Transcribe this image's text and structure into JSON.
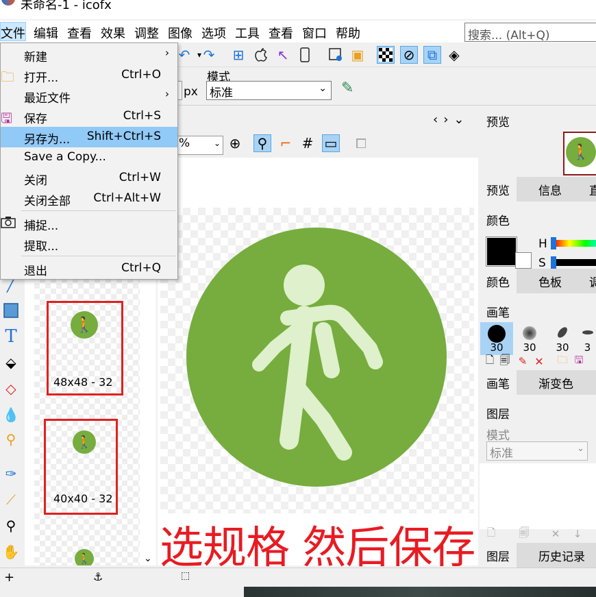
{
  "app": {
    "title": "未命名-1 - icofx"
  },
  "menubar": {
    "items": [
      "文件",
      "编辑",
      "查看",
      "效果",
      "调整",
      "图像",
      "选项",
      "工具",
      "查看",
      "窗口",
      "帮助"
    ],
    "search_placeholder": "搜索... (Alt+Q)"
  },
  "file_menu": {
    "items": [
      {
        "label": "新建",
        "shortcut": "",
        "submenu": true
      },
      {
        "label": "打开...",
        "shortcut": "Ctrl+O"
      },
      {
        "label": "最近文件",
        "shortcut": "",
        "submenu": true
      },
      {
        "label": "保存",
        "shortcut": "Ctrl+S"
      },
      {
        "label": "另存为...",
        "shortcut": "Shift+Ctrl+S",
        "highlighted": true
      },
      {
        "label": "Save a Copy...",
        "shortcut": ""
      },
      {
        "label": "关闭",
        "shortcut": "Ctrl+W"
      },
      {
        "label": "关闭全部",
        "shortcut": "Ctrl+Alt+W"
      },
      {
        "label": "捕捉...",
        "shortcut": ""
      },
      {
        "label": "提取...",
        "shortcut": ""
      },
      {
        "label": "退出",
        "shortcut": "Ctrl+Q"
      }
    ]
  },
  "tool_options": {
    "unit": "px",
    "mode_label": "模式",
    "mode_value": "标准"
  },
  "document": {
    "zoom_suffix": "%"
  },
  "thumbnails": [
    {
      "label": "48x48 - 32"
    },
    {
      "label": "40x40 - 32"
    }
  ],
  "annotation": "选规格 然后保存",
  "right_panel": {
    "preview_title": "预览",
    "preview_tabs": [
      "预览",
      "信息",
      "直"
    ],
    "color_title": "颜色",
    "h_label": "H",
    "s_label": "S",
    "color_tabs": [
      "颜色",
      "色板",
      "调"
    ],
    "brush_title": "画笔",
    "brush_sizes": [
      "30",
      "30",
      "30",
      "3"
    ],
    "brush_tabs": [
      "画笔",
      "渐变色"
    ],
    "layer_title": "图层",
    "layer_mode_label": "模式",
    "layer_mode_value": "标准",
    "layer_tabs": [
      "图层",
      "历史记录"
    ]
  },
  "colors": {
    "icon_green": "#76ad3e",
    "icon_figure": "#dff0cc",
    "annotation_red": "#e81b23",
    "thumb_border": "#e02020",
    "menu_highlight": "#91c9f7"
  }
}
